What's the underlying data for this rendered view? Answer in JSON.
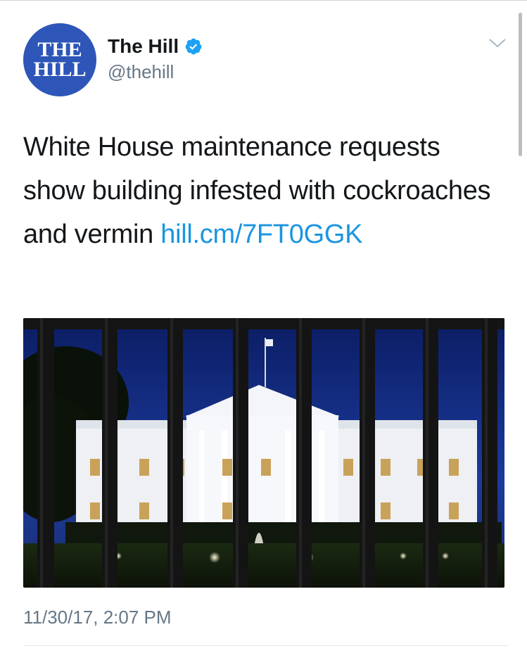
{
  "account": {
    "avatar_line1": "THE",
    "avatar_line2": "HILL",
    "display_name": "The Hill",
    "handle": "@thehill",
    "verified": true,
    "avatar_color": "#2d56b8",
    "verified_color": "#1da1f2"
  },
  "tweet": {
    "text": "White House maintenance requests show building infested with cockroaches and vermin ",
    "link_text": "hill.cm/7FT0GGK",
    "link_color": "#1b95e0",
    "timestamp": "11/30/17, 2:07 PM"
  },
  "icons": {
    "verified": "verified-badge-icon",
    "more": "chevron-down-icon"
  }
}
